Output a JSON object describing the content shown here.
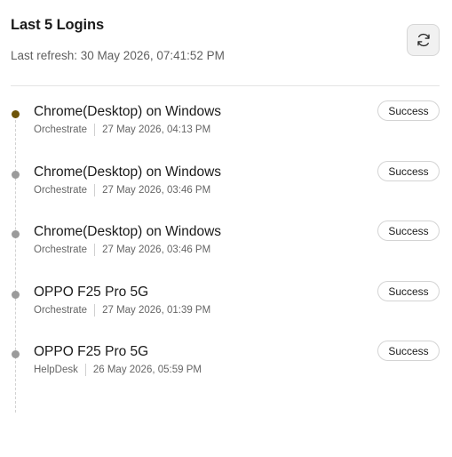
{
  "header": {
    "title": "Last 5 Logins",
    "last_refresh": "Last refresh: 30 May 2026, 07:41:52 PM"
  },
  "logins": [
    {
      "device": "Chrome(Desktop) on Windows",
      "app": "Orchestrate",
      "time": "27 May 2026, 04:13 PM",
      "status": "Success",
      "dot_color": "#6e5408"
    },
    {
      "device": "Chrome(Desktop) on Windows",
      "app": "Orchestrate",
      "time": "27 May 2026, 03:46 PM",
      "status": "Success",
      "dot_color": "#9b9b9b"
    },
    {
      "device": "Chrome(Desktop) on Windows",
      "app": "Orchestrate",
      "time": "27 May 2026, 03:46 PM",
      "status": "Success",
      "dot_color": "#9b9b9b"
    },
    {
      "device": "OPPO F25 Pro 5G",
      "app": "Orchestrate",
      "time": "27 May 2026, 01:39 PM",
      "status": "Success",
      "dot_color": "#9b9b9b"
    },
    {
      "device": "OPPO F25 Pro 5G",
      "app": "HelpDesk",
      "time": "26 May 2026, 05:59 PM",
      "status": "Success",
      "dot_color": "#9b9b9b"
    }
  ],
  "icons": {
    "refresh": "refresh-icon"
  }
}
